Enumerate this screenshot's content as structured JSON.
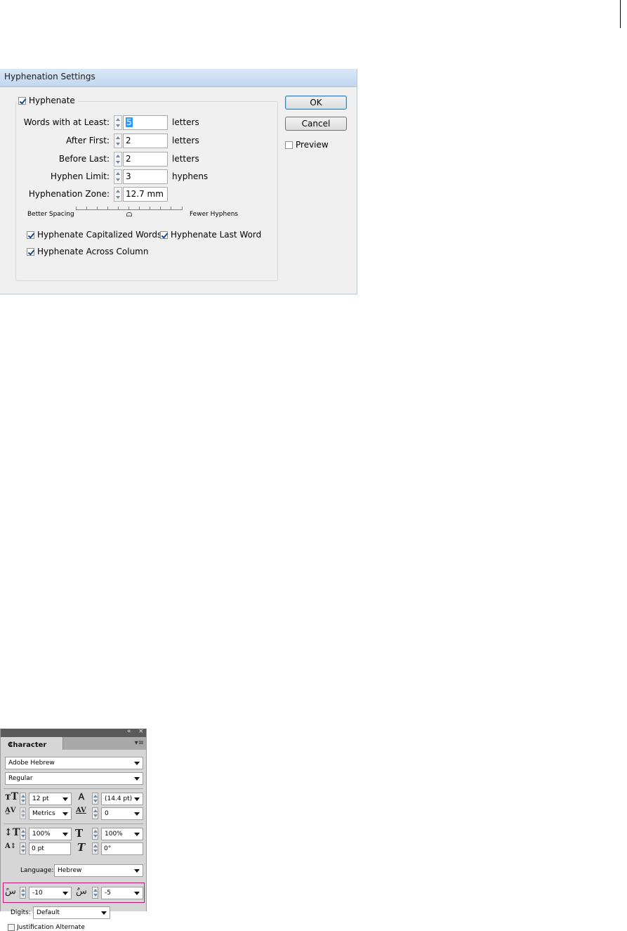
{
  "hyphenation_dialog": {
    "title": "Hyphenation Settings",
    "hyphenate": {
      "label": "Hyphenate",
      "checked": true
    },
    "fields": [
      {
        "label": "Words with at Least:",
        "value": "5",
        "unit": "letters"
      },
      {
        "label": "After First:",
        "value": "2",
        "unit": "letters"
      },
      {
        "label": "Before Last:",
        "value": "2",
        "unit": "letters"
      },
      {
        "label": "Hyphen Limit:",
        "value": "3",
        "unit": "hyphens"
      },
      {
        "label": "Hyphenation Zone:",
        "value": "12.7 mm",
        "unit": ""
      }
    ],
    "slider": {
      "left_label": "Better Spacing",
      "right_label": "Fewer Hyphens"
    },
    "options": [
      {
        "label": "Hyphenate Capitalized Words",
        "checked": true
      },
      {
        "label": "Hyphenate Last Word",
        "checked": true
      },
      {
        "label": "Hyphenate Across Column",
        "checked": true
      }
    ],
    "buttons": {
      "ok": "OK",
      "cancel": "Cancel"
    },
    "preview": {
      "label": "Preview",
      "checked": false
    }
  },
  "character_panel": {
    "tab_label": "Character",
    "panel_controls": {
      "collapse": "«",
      "close": "×",
      "menu": "▾≡"
    },
    "font_family": "Adobe Hebrew",
    "font_style": "Regular",
    "font_size": "12 pt",
    "leading": "(14.4 pt)",
    "kerning": "Metrics",
    "tracking": "0",
    "vertical_scale": "100%",
    "horizontal_scale": "100%",
    "baseline_shift": "0 pt",
    "skew": "0°",
    "language_label": "Language:",
    "language": "Hebrew",
    "diacritic_x": "-10",
    "diacritic_y": "-5",
    "digits_label": "Digits:",
    "digits": "Default",
    "justification_alternate": {
      "label": "Justification Alternate",
      "checked": false
    }
  }
}
